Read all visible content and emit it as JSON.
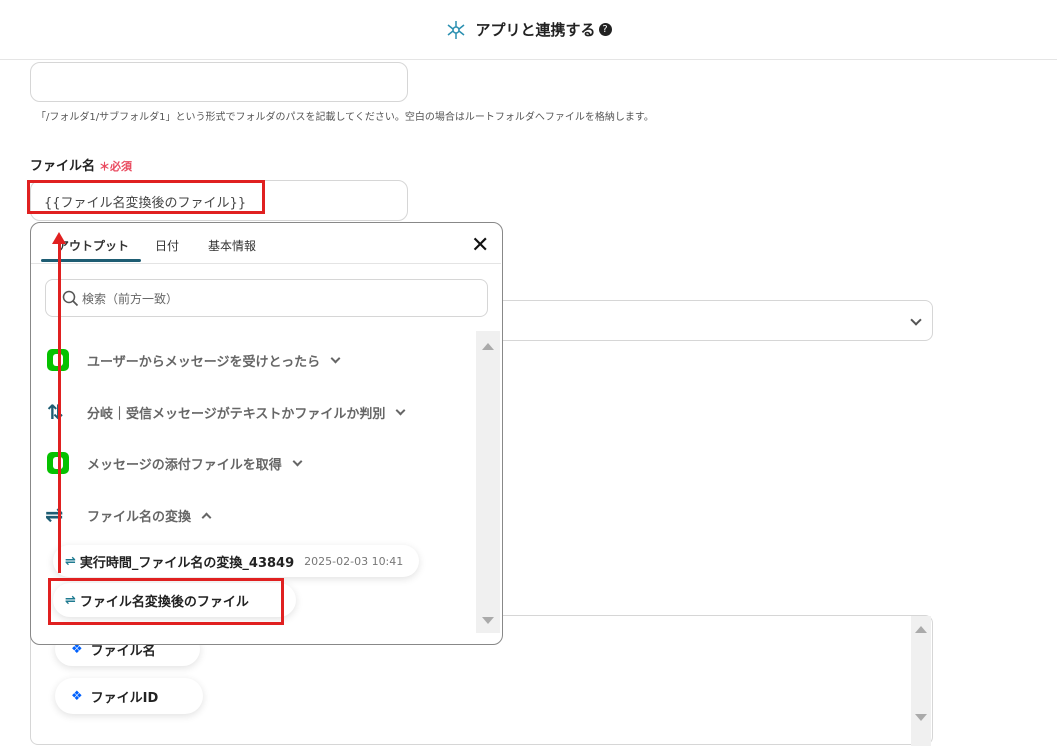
{
  "header": {
    "title": "アプリと連携する",
    "help": "?"
  },
  "folder_hint": "「/フォルダ1/サブフォルダ1」という形式でフォルダのパスを記載してください。空白の場合はルートフォルダへファイルを格納します。",
  "file_name": {
    "label": "ファイル名",
    "required_mark": "＊",
    "required": "必須",
    "value": "{{ファイル名変換後のファイル}}"
  },
  "popup": {
    "tabs": [
      "アウトプット",
      "日付",
      "基本情報"
    ],
    "search_placeholder": "検索（前方一致）",
    "items": [
      {
        "label": "ユーザーからメッセージを受けとったら",
        "icon": "line-icon"
      },
      {
        "label": "分岐｜受信メッセージがテキストかファイルか判別",
        "icon": "branch-icon"
      },
      {
        "label": "メッセージの添付ファイルを取得",
        "icon": "line-icon"
      },
      {
        "label": "ファイル名の変換",
        "icon": "convert-icon"
      }
    ],
    "sub_items": [
      {
        "label": "実行時間_ファイル名の変換_43849",
        "date": "2025-02-03 10:41"
      },
      {
        "label": "ファイル名変換後のファイル"
      }
    ]
  },
  "background_pills": [
    {
      "label": "ファイル名"
    },
    {
      "label": "ファイルID"
    }
  ],
  "colors": {
    "accent": "#1e5d73",
    "required": "#e94a5f",
    "highlight": "#e02020",
    "line": "#06c100",
    "dropbox": "#0061fe"
  }
}
